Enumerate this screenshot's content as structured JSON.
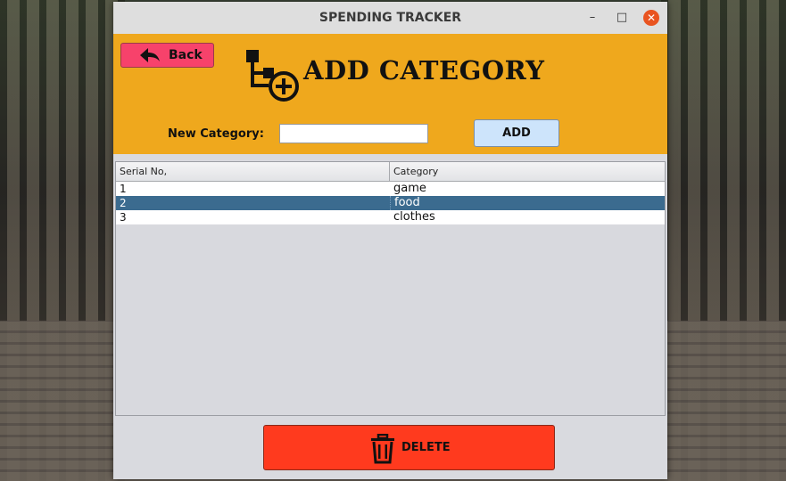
{
  "window": {
    "title": "SPENDING TRACKER",
    "controls": {
      "minimize": "–",
      "maximize": "□",
      "close": "✕"
    }
  },
  "header": {
    "back_label": "Back",
    "page_title": "ADD CATEGORY",
    "new_category_label": "New Category:",
    "new_category_value": "",
    "add_label": "ADD",
    "background_color": "#efa81d",
    "back_color": "#f7426b"
  },
  "table": {
    "columns": [
      "Serial No,",
      "Category"
    ],
    "rows": [
      {
        "serial": "1",
        "category": "game",
        "selected": false
      },
      {
        "serial": "2",
        "category": "food",
        "selected": true
      },
      {
        "serial": "3",
        "category": "clothes",
        "selected": false
      }
    ],
    "selection_color": "#3b6b8f"
  },
  "footer": {
    "delete_label": "DELETE",
    "delete_color": "#ff3a1e",
    "delete_icon": "trash-icon"
  }
}
